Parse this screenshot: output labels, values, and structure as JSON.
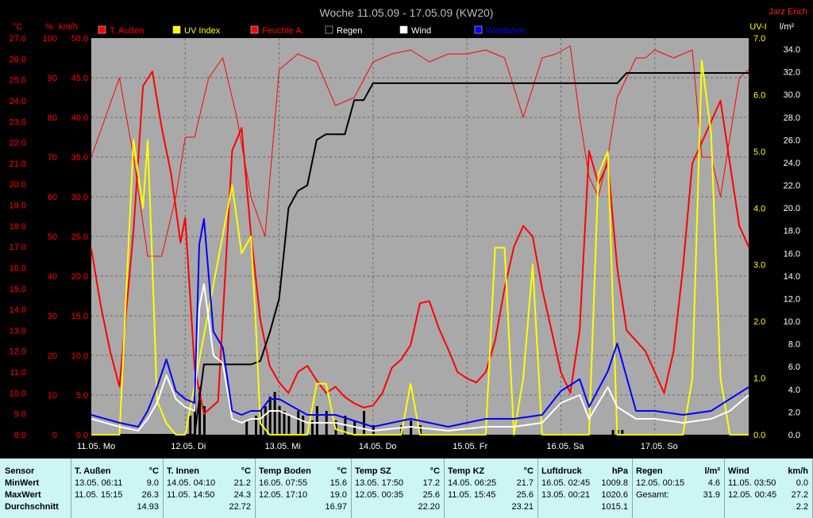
{
  "title": "Woche 11.05.09 - 17.05.09 (KW20)",
  "station": "Jarz Erich",
  "chart_data": {
    "type": "line",
    "x_labels": [
      "11.05. Mo",
      "12.05. Di",
      "13.05. Mi",
      "14.05. Do",
      "15.05. Fr",
      "16.05. Sa",
      "17.05. So"
    ],
    "axes": {
      "temp_c": {
        "unit": "°C",
        "ticks": [
          "27.0",
          "26.0",
          "25.0",
          "24.0",
          "23.0",
          "22.0",
          "21.0",
          "20.0",
          "19.0",
          "18.0",
          "17.0",
          "16.0",
          "15.0",
          "14.0",
          "13.0",
          "12.0",
          "11.0",
          "10.0",
          "9.0",
          "8.0"
        ],
        "ylim": [
          8,
          27
        ]
      },
      "humidity_pct": {
        "unit": "%",
        "ticks": [
          "100",
          "90",
          "80",
          "70",
          "60",
          "50",
          "40",
          "30",
          "20",
          "10",
          "0"
        ],
        "ylim": [
          0,
          100
        ]
      },
      "wind_kmh": {
        "unit": "km/h",
        "ticks": [
          "50.0",
          "45.0",
          "40.0",
          "35.0",
          "30.0",
          "25.0",
          "20.0",
          "15.0",
          "10.0",
          "5.0",
          "0.0"
        ],
        "ylim": [
          0,
          50
        ]
      },
      "uv_index": {
        "unit": "UV-I",
        "ticks": [
          "7.0",
          "6.0",
          "5.0",
          "4.0",
          "3.0",
          "2.0",
          "1.0",
          "0.0"
        ],
        "ylim": [
          0,
          7
        ]
      },
      "rain_lm2": {
        "unit": "l/m²",
        "ticks": [
          "34.0",
          "32.0",
          "30.0",
          "28.0",
          "26.0",
          "24.0",
          "22.0",
          "20.0",
          "18.0",
          "16.0",
          "14.0",
          "12.0",
          "10.0",
          "8.0",
          "6.0",
          "4.0",
          "2.0",
          "0.0"
        ],
        "ylim": [
          0,
          34
        ]
      }
    },
    "legend": [
      {
        "name": "T. Außen",
        "color": "#ff0000"
      },
      {
        "name": "UV Index",
        "color": "#ffff00"
      },
      {
        "name": "Feuchte A.",
        "color": "#ff0000"
      },
      {
        "name": "Regen",
        "color": "#000000"
      },
      {
        "name": "Wind",
        "color": "#ffffff"
      },
      {
        "name": "Windböen",
        "color": "#0000ff"
      }
    ],
    "x_days": 7,
    "series": [
      {
        "name": "T. Außen",
        "axis": "temp_c",
        "color": "#ff0000",
        "x": [
          0,
          0.1,
          0.2,
          0.3,
          0.45,
          0.55,
          0.65,
          0.75,
          0.85,
          0.95,
          1.0,
          1.1,
          1.2,
          1.35,
          1.5,
          1.6,
          1.7,
          1.8,
          1.9,
          2.0,
          2.1,
          2.2,
          2.3,
          2.4,
          2.5,
          2.6,
          2.7,
          2.8,
          2.9,
          3.0,
          3.1,
          3.2,
          3.3,
          3.4,
          3.5,
          3.6,
          3.7,
          3.8,
          3.9,
          4.0,
          4.1,
          4.2,
          4.3,
          4.4,
          4.5,
          4.6,
          4.7,
          4.8,
          4.9,
          5.0,
          5.1,
          5.2,
          5.3,
          5.4,
          5.5,
          5.6,
          5.7,
          5.8,
          5.9,
          6.0,
          6.1,
          6.2,
          6.3,
          6.4,
          6.5,
          6.6,
          6.7,
          6.8,
          6.9,
          7.0
        ],
        "y": [
          16.9,
          14.2,
          12.0,
          10.3,
          17.8,
          24.7,
          25.4,
          22.7,
          20.5,
          17.2,
          18.4,
          11.2,
          9.0,
          9.6,
          21.6,
          22.7,
          17.6,
          13.5,
          11.3,
          10.5,
          10.0,
          11.0,
          11.3,
          10.6,
          10.0,
          10.3,
          9.8,
          9.5,
          9.3,
          9.4,
          10.0,
          11.2,
          11.6,
          12.3,
          14.3,
          14.4,
          13.1,
          12.1,
          11.0,
          10.7,
          10.5,
          11.0,
          12.5,
          15.0,
          17.0,
          18.0,
          17.5,
          15.0,
          13.0,
          11.0,
          10.0,
          13.0,
          21.6,
          20.0,
          21.0,
          16.0,
          13.0,
          12.5,
          12.0,
          11.0,
          10.0,
          12.0,
          16.0,
          21.0,
          22.0,
          23.0,
          24.0,
          21.0,
          18.0,
          17.0
        ]
      },
      {
        "name": "Feuchte A.",
        "axis": "humidity_pct",
        "color": "#ff0000",
        "x": [
          0,
          0.15,
          0.3,
          0.45,
          0.6,
          0.75,
          0.9,
          1.0,
          1.1,
          1.25,
          1.4,
          1.55,
          1.7,
          1.85,
          2.0,
          2.2,
          2.4,
          2.6,
          2.8,
          3.0,
          3.2,
          3.4,
          3.6,
          3.8,
          4.0,
          4.2,
          4.4,
          4.6,
          4.8,
          4.95,
          5.1,
          5.2,
          5.3,
          5.4,
          5.5,
          5.6,
          5.7,
          5.8,
          5.9,
          6.0,
          6.2,
          6.4,
          6.5,
          6.6,
          6.7,
          6.8,
          6.9,
          7.0
        ],
        "y": [
          70,
          80,
          90,
          70,
          45,
          45,
          60,
          75,
          75,
          90,
          95,
          80,
          60,
          50,
          92,
          96,
          94,
          83,
          85,
          94,
          96,
          97,
          94,
          96,
          96,
          97,
          95,
          80,
          95,
          96,
          98,
          80,
          65,
          60,
          70,
          85,
          90,
          95,
          95,
          97,
          95,
          97,
          70,
          70,
          60,
          75,
          90,
          92
        ]
      },
      {
        "name": "Regen",
        "axis": "rain_lm2",
        "color": "#000000",
        "x": [
          0,
          0.8,
          1.1,
          1.2,
          1.7,
          1.8,
          1.9,
          2.0,
          2.1,
          2.2,
          2.3,
          2.4,
          2.5,
          2.6,
          2.7,
          2.8,
          2.9,
          3.0,
          3.1,
          3.2,
          3.3,
          3.4,
          3.5,
          4.0,
          4.5,
          5.0,
          5.5,
          5.6,
          5.7,
          6.0,
          7.0
        ],
        "y": [
          0,
          0,
          0,
          6.2,
          6.2,
          6.5,
          9.0,
          12.0,
          20.0,
          21.5,
          22.0,
          26.0,
          26.5,
          26.5,
          26.5,
          29.5,
          29.5,
          31.0,
          31.0,
          31.0,
          31.0,
          31.0,
          31.0,
          31.0,
          31.0,
          31.0,
          31.0,
          31.0,
          31.9,
          31.9,
          31.9
        ]
      },
      {
        "name": "UV Index",
        "axis": "uv_index",
        "color": "#ffff00",
        "x": [
          0,
          0.3,
          0.45,
          0.55,
          0.6,
          0.65,
          0.7,
          0.8,
          0.9,
          1.0,
          1.5,
          1.6,
          1.7,
          1.75,
          1.8,
          1.9,
          2.0,
          2.3,
          2.4,
          2.5,
          2.6,
          2.8,
          3.0,
          3.3,
          3.4,
          3.5,
          3.7,
          4.2,
          4.3,
          4.4,
          4.5,
          4.6,
          4.7,
          4.8,
          5.0,
          5.3,
          5.4,
          5.5,
          5.6,
          5.7,
          5.8,
          6.0,
          6.2,
          6.3,
          6.4,
          6.5,
          6.6,
          6.7,
          6.8,
          6.9,
          7.0
        ],
        "y": [
          0,
          0,
          5.2,
          4.0,
          5.2,
          3.0,
          0.6,
          0.2,
          0,
          0,
          4.4,
          3.2,
          3.5,
          2.0,
          0.2,
          0,
          0,
          0,
          0.9,
          0.9,
          0.1,
          0,
          0,
          0,
          0.9,
          0,
          0,
          0,
          3.3,
          3.3,
          0,
          1.0,
          3.0,
          0,
          0,
          0,
          4.6,
          5.0,
          0,
          0,
          0,
          0,
          0,
          0,
          1.0,
          6.6,
          5.3,
          1.0,
          0,
          0,
          0
        ]
      },
      {
        "name": "Wind",
        "axis": "wind_kmh",
        "color": "#ffffff",
        "x": [
          0,
          0.3,
          0.5,
          0.6,
          0.7,
          0.8,
          0.9,
          1.0,
          1.1,
          1.15,
          1.2,
          1.3,
          1.4,
          1.5,
          1.6,
          1.7,
          1.8,
          1.9,
          2.0,
          2.3,
          2.6,
          3.0,
          3.4,
          3.8,
          4.2,
          4.5,
          4.8,
          5.0,
          5.2,
          5.3,
          5.5,
          5.6,
          5.8,
          6.0,
          6.3,
          6.6,
          6.8,
          7.0
        ],
        "y": [
          2.0,
          1.0,
          0.5,
          2.0,
          4.0,
          7.5,
          4.5,
          3.5,
          3.0,
          16.0,
          19.0,
          10.0,
          9.0,
          2.0,
          1.5,
          2.0,
          2.0,
          3.0,
          3.0,
          1.5,
          1.5,
          0.5,
          1.0,
          0.5,
          1.0,
          1.0,
          1.5,
          4.0,
          5.0,
          2.0,
          6.0,
          3.5,
          2.0,
          2.0,
          1.5,
          2.0,
          3.0,
          5.0
        ]
      },
      {
        "name": "Windböen",
        "axis": "wind_kmh",
        "color": "#0000ff",
        "x": [
          0,
          0.3,
          0.5,
          0.6,
          0.7,
          0.8,
          0.9,
          1.0,
          1.1,
          1.15,
          1.2,
          1.3,
          1.4,
          1.5,
          1.6,
          1.7,
          1.8,
          1.9,
          2.0,
          2.3,
          2.6,
          3.0,
          3.4,
          3.8,
          4.2,
          4.5,
          4.8,
          5.0,
          5.2,
          5.3,
          5.5,
          5.6,
          5.8,
          6.0,
          6.3,
          6.6,
          6.8,
          7.0
        ],
        "y": [
          2.5,
          1.5,
          1.0,
          3.0,
          6.0,
          9.5,
          5.5,
          4.5,
          4.0,
          24.0,
          27.2,
          13.0,
          11.0,
          3.0,
          2.5,
          3.0,
          3.0,
          4.5,
          4.5,
          2.5,
          2.5,
          1.0,
          2.0,
          1.0,
          2.0,
          2.0,
          2.5,
          5.5,
          7.0,
          3.5,
          8.0,
          11.5,
          3.0,
          3.0,
          2.5,
          3.0,
          4.5,
          6.0
        ]
      }
    ]
  },
  "stats": {
    "row_labels": [
      "Sensor",
      "MinWert",
      "MaxWert",
      "Durchschnitt"
    ],
    "columns": [
      {
        "name": "T. Außen",
        "unit": "°C",
        "min_time": "13.05.  06:11",
        "min": "9.0",
        "max_time": "11.05.  15:15",
        "max": "26.3",
        "avg": "14.93"
      },
      {
        "name": "T. Innen",
        "unit": "°C",
        "min_time": "14.05.  04:10",
        "min": "21.2",
        "max_time": "11.05.  14:50",
        "max": "24.3",
        "avg": "22.72"
      },
      {
        "name": "Temp Boden",
        "unit": "°C",
        "min_time": "16.05.  07:55",
        "min": "15.6",
        "max_time": "12.05.  17:10",
        "max": "19.0",
        "avg": "16.97"
      },
      {
        "name": "Temp SZ",
        "unit": "°C",
        "min_time": "13.05.  17:50",
        "min": "17.2",
        "max_time": "12.05.  00:35",
        "max": "25.6",
        "avg": "22.20"
      },
      {
        "name": "Temp KZ",
        "unit": "°C",
        "min_time": "14.05.  06:25",
        "min": "21.7",
        "max_time": "11.05.  15:45",
        "max": "25.6",
        "avg": "23.21"
      },
      {
        "name": "Luftdruck",
        "unit": "hPa",
        "min_time": "16.05.  02:45",
        "min": "1009.8",
        "max_time": "13.05.  00:21",
        "max": "1020.6",
        "avg": "1015.1"
      },
      {
        "name": "Regen",
        "unit": "l/m²",
        "min_time": "12.05.  00:15",
        "min": "4.6",
        "max_time": "Gesamt:",
        "max": "31.9",
        "avg": ""
      },
      {
        "name": "Wind",
        "unit": "km/h",
        "min_time": "11.05.  03:50",
        "min": "0.0",
        "max_time": "12.05.  00:45",
        "max": "27.2",
        "avg": "2.2"
      }
    ]
  }
}
